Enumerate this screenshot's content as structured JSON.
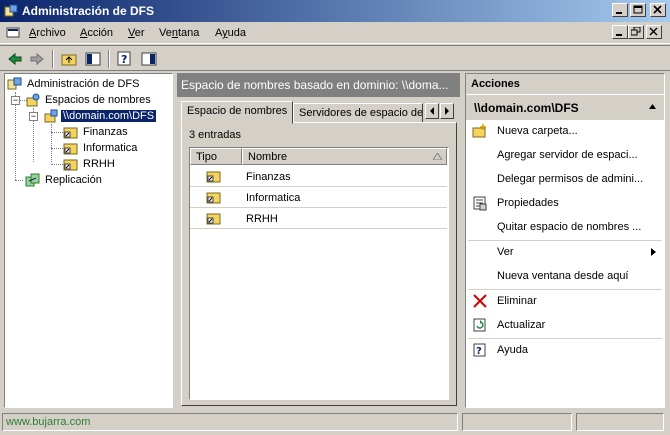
{
  "window": {
    "title": "Administración de DFS"
  },
  "menu": {
    "items": [
      {
        "pre": "",
        "u": "A",
        "post": "rchivo"
      },
      {
        "pre": "",
        "u": "A",
        "post": "cción"
      },
      {
        "pre": "",
        "u": "V",
        "post": "er"
      },
      {
        "pre": "Ve",
        "u": "n",
        "post": "tana"
      },
      {
        "pre": "A",
        "u": "y",
        "post": "uda"
      }
    ]
  },
  "tree": {
    "root": "Administración de DFS",
    "namespaces": "Espacios de nombres",
    "selected": "\\\\domain.com\\DFS",
    "folders": [
      "Finanzas",
      "Informatica",
      "RRHH"
    ],
    "replication": "Replicación",
    "expander_minus": "−"
  },
  "center": {
    "header": "Espacio de nombres basado en dominio: \\\\doma...",
    "tabs": [
      "Espacio de nombres",
      "Servidores de espacio de n"
    ],
    "entries": "3 entradas",
    "columns": [
      "Tipo",
      "Nombre"
    ],
    "rows": [
      "Finanzas",
      "Informatica",
      "RRHH"
    ]
  },
  "actions": {
    "header": "Acciones",
    "subheader": "\\\\domain.com\\DFS",
    "items": [
      {
        "label": "Nueva carpeta...",
        "icon": "new-folder-icon"
      },
      {
        "label": "Agregar servidor de espaci...",
        "icon": ""
      },
      {
        "label": "Delegar permisos de admini...",
        "icon": ""
      },
      {
        "label": "Propiedades",
        "icon": "properties-icon"
      },
      {
        "label": "Quitar espacio de nombres ...",
        "icon": ""
      },
      {
        "label": "Ver",
        "icon": "",
        "submenu": true
      },
      {
        "label": "Nueva ventana desde aquí",
        "icon": ""
      },
      {
        "label": "Eliminar",
        "icon": "delete-icon"
      },
      {
        "label": "Actualizar",
        "icon": "refresh-icon"
      },
      {
        "label": "Ayuda",
        "icon": "help-icon"
      }
    ]
  },
  "status": {
    "watermark": "www.bujarra.com"
  },
  "colors": {
    "title_start": "#0a246a",
    "title_end": "#a6caf0",
    "selection": "#0a246a",
    "pane_header": "#808080",
    "delete": "#d40000",
    "watermark": "#2e7d32"
  }
}
